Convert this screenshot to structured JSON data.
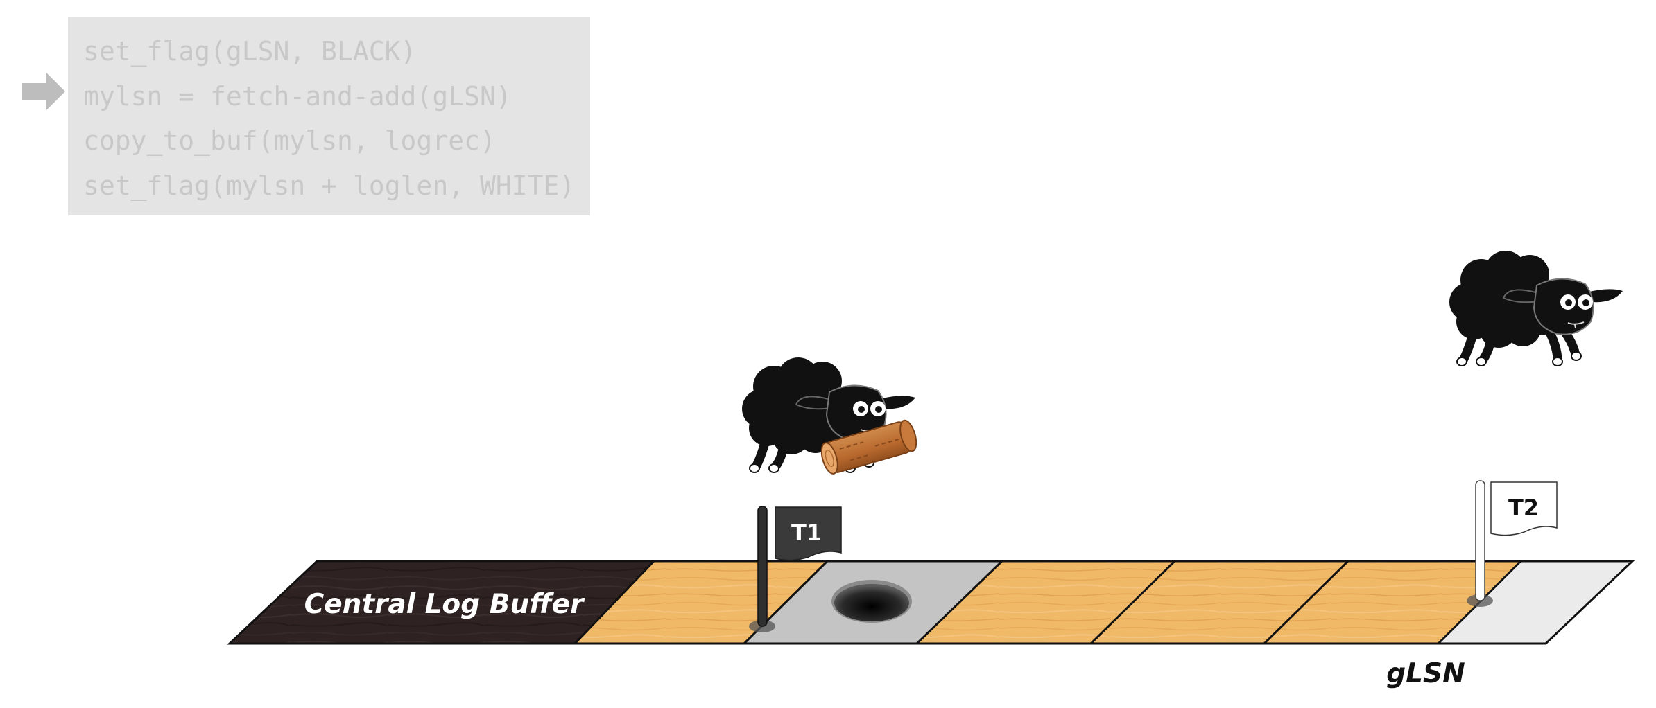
{
  "code": {
    "lines": [
      "set_flag(gLSN, BLACK)",
      "mylsn = fetch-and-add(gLSN)",
      "copy_to_buf(mylsn, logrec)",
      "set_flag(mylsn + loglen, WHITE)"
    ],
    "current_line_index": 1
  },
  "buffer": {
    "label": "Central Log Buffer",
    "pointer_label": "gLSN",
    "segments": [
      {
        "kind": "wood-dark"
      },
      {
        "kind": "wood-light"
      },
      {
        "kind": "hole"
      },
      {
        "kind": "wood-light"
      },
      {
        "kind": "wood-light"
      },
      {
        "kind": "wood-light"
      },
      {
        "kind": "empty"
      }
    ]
  },
  "flags": [
    {
      "label": "T1",
      "color": "#3a3a3a"
    },
    {
      "label": "T2",
      "color": "#ffffff"
    }
  ],
  "colors": {
    "wood_dark": "#2e2222",
    "wood_light": "#f0b968",
    "hole_cell": "#c4c4c4",
    "empty_cell": "#ebebeb",
    "code_bg": "#e4e4e4",
    "code_text": "#c8c8c8",
    "arrow": "#bdbdbd"
  },
  "icons": [
    "sheep-icon",
    "log-icon",
    "flag-icon",
    "arrow-right-icon"
  ]
}
